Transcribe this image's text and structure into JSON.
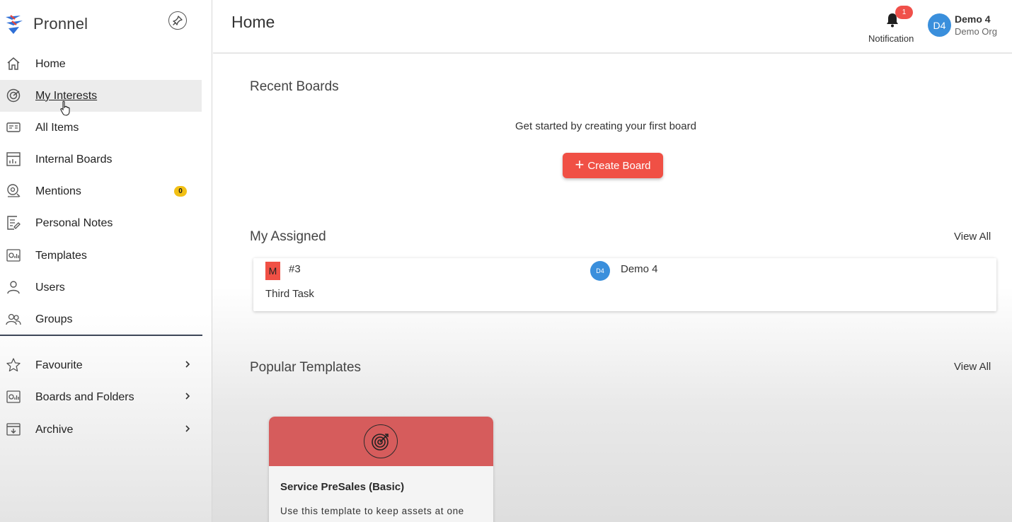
{
  "app": {
    "name": "Pronnel"
  },
  "sidebar": {
    "items": [
      {
        "label": "Home",
        "icon": "home-icon"
      },
      {
        "label": "My Interests",
        "icon": "radar-icon"
      },
      {
        "label": "All Items",
        "icon": "list-card-icon"
      },
      {
        "label": "Internal Boards",
        "icon": "board-chart-icon"
      },
      {
        "label": "Mentions",
        "icon": "mention-icon",
        "badge": "0"
      },
      {
        "label": "Personal Notes",
        "icon": "note-edit-icon"
      },
      {
        "label": "Templates",
        "icon": "template-icon"
      },
      {
        "label": "Users",
        "icon": "user-icon"
      },
      {
        "label": "Groups",
        "icon": "group-icon"
      }
    ],
    "expandable": [
      {
        "label": "Favourite",
        "icon": "star-icon"
      },
      {
        "label": "Boards and Folders",
        "icon": "folder-board-icon"
      },
      {
        "label": "Archive",
        "icon": "archive-icon"
      }
    ]
  },
  "header": {
    "title": "Home",
    "notification": {
      "label": "Notification",
      "count": "1"
    },
    "user": {
      "initials": "D4",
      "name": "Demo 4",
      "org": "Demo Org"
    }
  },
  "recent_boards": {
    "title": "Recent Boards",
    "empty_message": "Get started by creating your first board",
    "create_label": "Create Board"
  },
  "my_assigned": {
    "title": "My Assigned",
    "view_all": "View All",
    "items": [
      {
        "priority": "M",
        "number": "#3",
        "name": "Third Task",
        "assignee_initials": "D4",
        "assignee_name": "Demo 4"
      }
    ]
  },
  "popular_templates": {
    "title": "Popular Templates",
    "view_all": "View All",
    "items": [
      {
        "name": "Service PreSales (Basic)",
        "description": "Use this template to keep assets at one",
        "icon": "target-icon"
      }
    ]
  },
  "colors": {
    "accent": "#f05045",
    "avatar": "#3a8fdc",
    "template_header": "#d65c5c",
    "badge": "#f2c014"
  }
}
